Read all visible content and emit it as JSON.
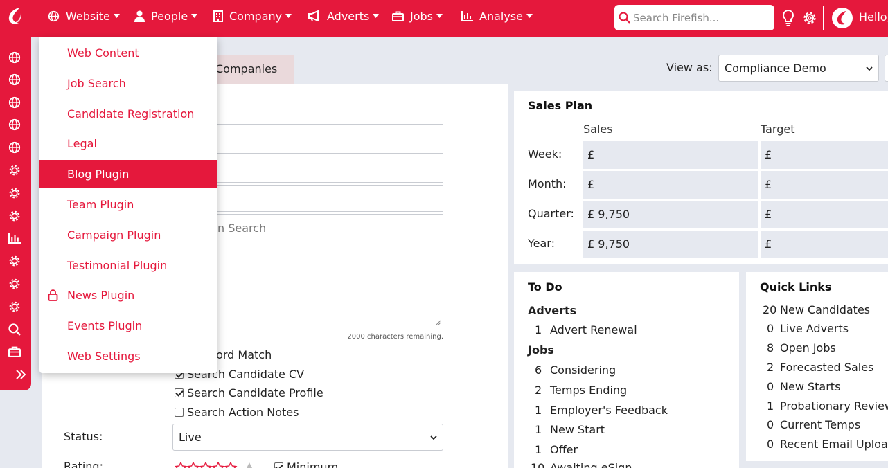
{
  "brand_color": "#e5183c",
  "nav": {
    "website": "Website",
    "people": "People",
    "company": "Company",
    "adverts": "Adverts",
    "jobs": "Jobs",
    "analyse": "Analyse"
  },
  "search": {
    "placeholder": "Search Firefish..."
  },
  "greeting": "Hello,",
  "website_menu": {
    "items": [
      {
        "label": "Web Content",
        "active": false,
        "locked": false
      },
      {
        "label": "Job Search",
        "active": false,
        "locked": false
      },
      {
        "label": "Candidate Registration",
        "active": false,
        "locked": false
      },
      {
        "label": "Legal",
        "active": false,
        "locked": false
      },
      {
        "label": "Blog Plugin",
        "active": true,
        "locked": false
      },
      {
        "label": "Team Plugin",
        "active": false,
        "locked": false
      },
      {
        "label": "Campaign Plugin",
        "active": false,
        "locked": false
      },
      {
        "label": "Testimonial Plugin",
        "active": false,
        "locked": false
      },
      {
        "label": "News Plugin",
        "active": false,
        "locked": true
      },
      {
        "label": "Events Plugin",
        "active": false,
        "locked": false
      },
      {
        "label": "Web Settings",
        "active": false,
        "locked": false
      }
    ]
  },
  "search_form": {
    "tab_label": "Companies",
    "textarea_placeholder_fragment": "n Search",
    "chars_remaining": "2000 characters remaining.",
    "options": [
      {
        "label": "Keyword Match",
        "checked": null
      },
      {
        "label": "Search Candidate CV",
        "checked": true
      },
      {
        "label": "Search Candidate Profile",
        "checked": true
      },
      {
        "label": "Search Action Notes",
        "checked": false
      }
    ],
    "status_label": "Status:",
    "status_value": "Live",
    "rating_label": "Rating:",
    "minimum_label": "Minimum"
  },
  "view_as": {
    "label": "View as:",
    "value": "Compliance Demo"
  },
  "sales_plan": {
    "title": "Sales Plan",
    "col_sales": "Sales",
    "col_target": "Target",
    "rows": [
      {
        "label": "Week:",
        "sales": "£",
        "target": "£"
      },
      {
        "label": "Month:",
        "sales": "£",
        "target": "£"
      },
      {
        "label": "Quarter:",
        "sales": "£ 9,750",
        "target": "£"
      },
      {
        "label": "Year:",
        "sales": "£ 9,750",
        "target": "£"
      }
    ]
  },
  "todo": {
    "title": "To Do",
    "adverts_heading": "Adverts",
    "adverts": [
      {
        "count": "1",
        "label": "Advert Renewal"
      }
    ],
    "jobs_heading": "Jobs",
    "jobs": [
      {
        "count": "6",
        "label": "Considering"
      },
      {
        "count": "2",
        "label": "Temps Ending"
      },
      {
        "count": "1",
        "label": "Employer's Feedback"
      },
      {
        "count": "1",
        "label": "New Start"
      },
      {
        "count": "1",
        "label": "Offer"
      },
      {
        "count": "10",
        "label": "Awaiting eSign"
      }
    ]
  },
  "quick_links": {
    "title": "Quick Links",
    "items": [
      {
        "count": "20",
        "label": "New Candidates"
      },
      {
        "count": "0",
        "label": "Live Adverts"
      },
      {
        "count": "8",
        "label": "Open Jobs"
      },
      {
        "count": "2",
        "label": "Forecasted Sales"
      },
      {
        "count": "0",
        "label": "New Starts"
      },
      {
        "count": "1",
        "label": "Probationary Reviews"
      },
      {
        "count": "0",
        "label": "Current Temps"
      },
      {
        "count": "0",
        "label": "Recent Email Uploads"
      }
    ]
  },
  "sidebar_icons": [
    "globe-icon",
    "globe-icon",
    "globe-icon",
    "globe-icon",
    "globe-icon",
    "gear-icon",
    "gear-icon",
    "gear-icon",
    "bar-chart-icon",
    "gear-icon",
    "gear-icon",
    "gear-icon",
    "search-icon",
    "briefcase-icon",
    "expand-icon"
  ]
}
